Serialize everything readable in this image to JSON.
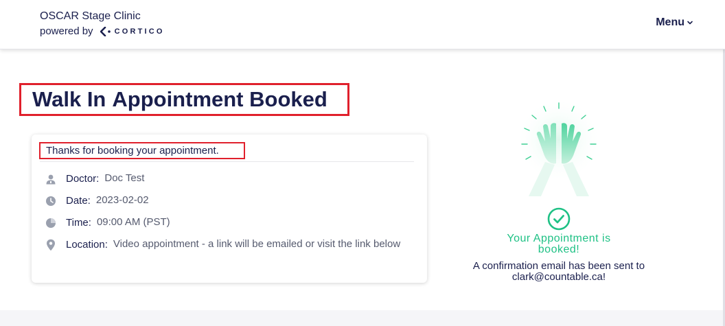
{
  "header": {
    "clinic_name": "OSCAR Stage Clinic",
    "powered_by": "powered by",
    "logo_text": "CORTICO",
    "menu_label": "Menu"
  },
  "page": {
    "title_bold": "Walk In",
    "title_rest": "Appointment Booked"
  },
  "details": {
    "thanks": "Thanks for booking your appointment.",
    "rows": [
      {
        "icon": "user-icon",
        "label": "Doctor:",
        "value": "Doc Test"
      },
      {
        "icon": "clock-icon",
        "label": "Date:",
        "value": "2023-02-02"
      },
      {
        "icon": "pie-clock-icon",
        "label": "Time:",
        "value": "09:00 AM (PST)"
      },
      {
        "icon": "location-pin-icon",
        "label": "Location:",
        "value": "Video appointment - a link will be emailed or visit the link below"
      }
    ]
  },
  "confirmation": {
    "status": "Your Appointment is booked!",
    "message": "A confirmation email has been sent to clark@countable.ca!"
  },
  "colors": {
    "navy": "#1a1f4d",
    "accent_green": "#1fc185",
    "highlight_red": "#e0202c"
  }
}
